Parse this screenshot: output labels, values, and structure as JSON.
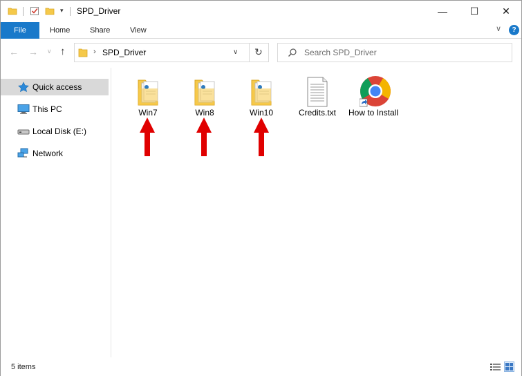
{
  "window": {
    "title": "SPD_Driver",
    "minimize_glyph": "—",
    "maximize_glyph": "☐",
    "close_glyph": "✕"
  },
  "quick_access_toolbar": {
    "dropdown_glyph": "▾"
  },
  "ribbon": {
    "tabs": [
      {
        "label": "File"
      },
      {
        "label": "Home"
      },
      {
        "label": "Share"
      },
      {
        "label": "View"
      }
    ],
    "collapse_glyph": "∨",
    "help_glyph": "?"
  },
  "navigation": {
    "back_glyph": "←",
    "forward_glyph": "→",
    "recent_glyph": "∨",
    "up_glyph": "↑",
    "address": {
      "separator": "›",
      "path": "SPD_Driver",
      "dropdown_glyph": "∨",
      "refresh_glyph": "↻"
    },
    "search": {
      "placeholder": "Search SPD_Driver"
    }
  },
  "sidebar": {
    "items": [
      {
        "label": "Quick access",
        "icon": "star-icon",
        "selected": true
      },
      {
        "label": "This PC",
        "icon": "computer-icon",
        "selected": false
      },
      {
        "label": "Local Disk (E:)",
        "icon": "drive-icon",
        "selected": false
      },
      {
        "label": "Network",
        "icon": "network-icon",
        "selected": false
      }
    ]
  },
  "files": [
    {
      "label": "Win7",
      "type": "folder",
      "icon": "folder-icon"
    },
    {
      "label": "Win8",
      "type": "folder",
      "icon": "folder-icon"
    },
    {
      "label": "Win10",
      "type": "folder",
      "icon": "folder-icon"
    },
    {
      "label": "Credits.txt",
      "type": "text",
      "icon": "text-file-icon"
    },
    {
      "label": "How to Install",
      "type": "shortcut",
      "icon": "chrome-shortcut-icon"
    }
  ],
  "annotations": {
    "arrow_color": "#e00000",
    "arrows_point_to": [
      "Win7",
      "Win8",
      "Win10"
    ]
  },
  "status": {
    "item_count": "5 items"
  },
  "colors": {
    "file_tab": "#1979ca",
    "selected_sidebar": "#d9d9d9",
    "folder": "#f5c94a"
  }
}
